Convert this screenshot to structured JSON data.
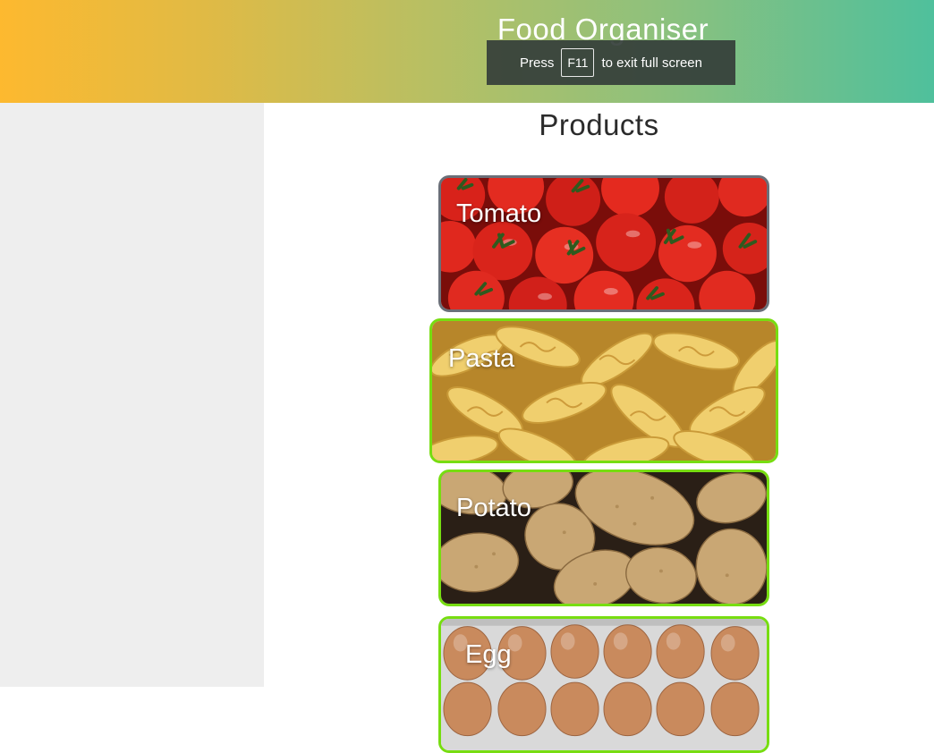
{
  "header": {
    "app_title": "Food Organiser"
  },
  "fullscreen_toast": {
    "prefix": "Press",
    "key": "F11",
    "suffix": "to exit full screen"
  },
  "main": {
    "section_title": "Products",
    "products": [
      {
        "label": "Tomato",
        "image": "tomatoes-photo",
        "border_color": "#6a6f78"
      },
      {
        "label": "Pasta",
        "image": "fusilli-pasta-photo",
        "border_color": "#77dd11"
      },
      {
        "label": "Potato",
        "image": "potatoes-photo",
        "border_color": "#77dd11"
      },
      {
        "label": "Egg",
        "image": "eggs-photo",
        "border_color": "#77dd11"
      }
    ]
  },
  "colors": {
    "header_gradient_start": "#fdb92f",
    "header_gradient_end": "#4fc09c",
    "sidebar_bg": "#eeeeee",
    "selected_border": "#77dd11"
  }
}
